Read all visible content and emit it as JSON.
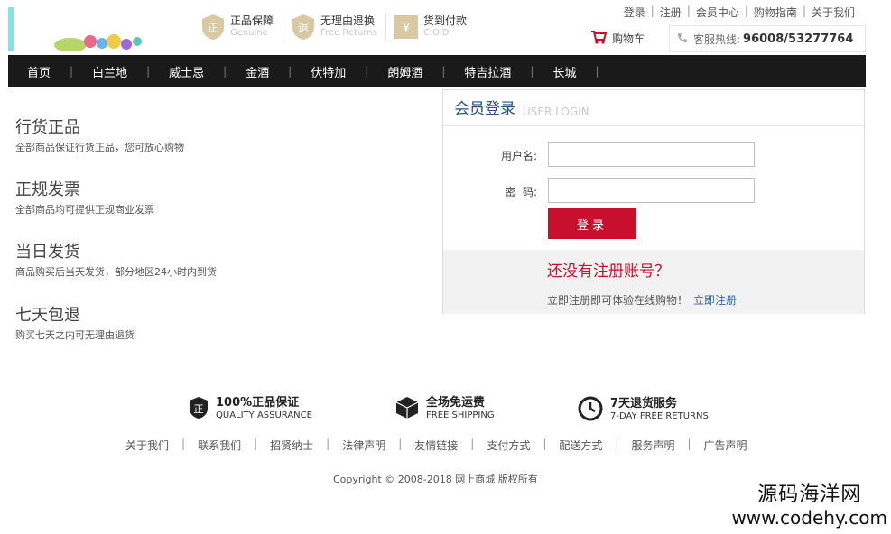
{
  "promises": [
    {
      "icon": "genuine-badge-icon",
      "glyph": "正",
      "title": "正品保障",
      "en": "Genuine"
    },
    {
      "icon": "returns-badge-icon",
      "glyph": "退",
      "title": "无理由退换",
      "en": "Free Returns"
    },
    {
      "icon": "cod-badge-icon",
      "glyph": "¥",
      "title": "货到付款",
      "en": "C.O.D"
    }
  ],
  "top_links": [
    "登录",
    "注册",
    "会员中心",
    "购物指南",
    "关于我们"
  ],
  "cart_label": "购物车",
  "hotline": {
    "label": "客服热线:",
    "number": "96008/53277764"
  },
  "nav": [
    "首页",
    "白兰地",
    "威士忌",
    "金酒",
    "伏特加",
    "朗姆酒",
    "特吉拉酒",
    "长城"
  ],
  "features": [
    {
      "title": "行货正品",
      "desc": "全部商品保证行货正品，您可放心购物"
    },
    {
      "title": "正规发票",
      "desc": "全部商品均可提供正规商业发票"
    },
    {
      "title": "当日发货",
      "desc": "商品购买后当天发货，部分地区24小时内到货"
    },
    {
      "title": "七天包退",
      "desc": "购买七天之内可无理由退货"
    }
  ],
  "login": {
    "title": "会员登录",
    "title_en": "USER LOGIN",
    "username_label": "用户名:",
    "password_label": "密  码:",
    "submit": "登录",
    "no_account": "还没有注册账号？",
    "register_tip": "立即注册即可体验在线购物！",
    "register_link": "立即注册"
  },
  "guarantees": [
    {
      "title": "100%正品保证",
      "en": "QUALITY ASSURANCE"
    },
    {
      "title": "全场免运费",
      "en": "FREE SHIPPING"
    },
    {
      "title": "7天退货服务",
      "en": "7-DAY FREE RETURNS"
    }
  ],
  "footer_links": [
    "关于我们",
    "联系我们",
    "招贤纳士",
    "法律声明",
    "友情链接",
    "支付方式",
    "配送方式",
    "服务声明",
    "广告声明"
  ],
  "copyright": "Copyright © 2008-2018 网上商城 版权所有",
  "watermark": {
    "line1": "源码海洋网",
    "line2": "www.codehy.com"
  },
  "colors": {
    "accent": "#c8102e",
    "nav_bg": "#1a1a1a",
    "link": "#2c6ab1",
    "title_blue": "#2c4f7c"
  }
}
